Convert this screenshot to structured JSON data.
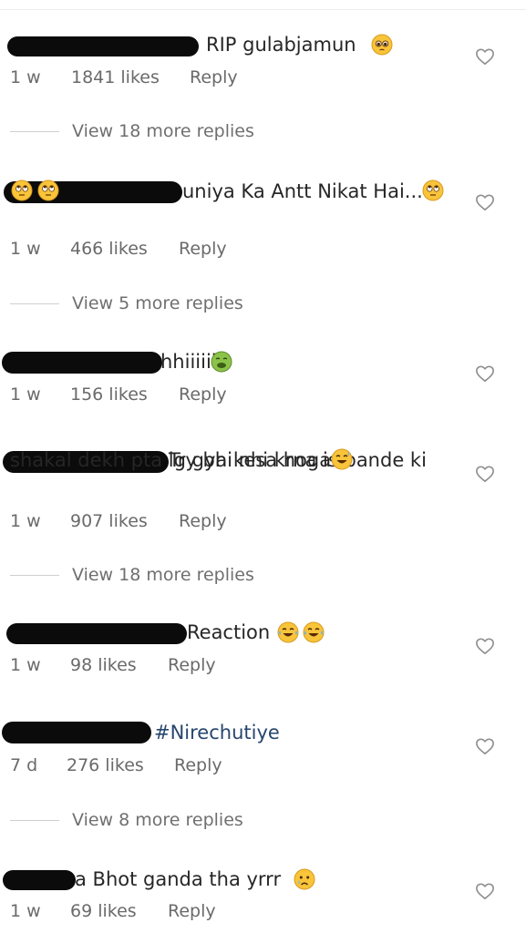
{
  "comments": [
    {
      "text": "RIP gulabjamun",
      "emoji": "pleading-face",
      "time": "1 w",
      "likes": "1841 likes",
      "reply": "Reply",
      "replies": "View 18 more replies"
    },
    {
      "text": "uniya Ka Antt Nikat Hai...",
      "emoji": "eye-roll-face",
      "extra_emojis": [
        "eye-roll-face",
        "eye-roll-face"
      ],
      "time": "1 w",
      "likes": "466 likes",
      "reply": "Reply",
      "replies": "View 5 more replies"
    },
    {
      "text": "hhiiiiii",
      "emoji": "nauseated-face",
      "time": "1 w",
      "likes": "156 likes",
      "reply": "Reply"
    },
    {
      "text": "Try bhi nhi krna is bande ki",
      "text_line2": "shakal dekh pta lg gya kesa hoga",
      "emoji": "grinning-sweat-face",
      "time": "1 w",
      "likes": "907 likes",
      "reply": "Reply",
      "replies": "View 18 more replies"
    },
    {
      "text": "Reaction",
      "emoji": "tears-of-joy-face",
      "time": "1 w",
      "likes": "98 likes",
      "reply": "Reply"
    },
    {
      "text": "#Nirechutiye",
      "time": "7 d",
      "likes": "276 likes",
      "reply": "Reply",
      "replies": "View 8 more replies"
    },
    {
      "text": "a Bhot ganda tha yrrr",
      "emoji": "crying-face",
      "time": "1 w",
      "likes": "69 likes",
      "reply": "Reply"
    }
  ],
  "colors": {
    "text": "#262626",
    "meta": "#6a6a6a",
    "hashtag": "#27466d",
    "redaction": "#0b0b0b"
  }
}
